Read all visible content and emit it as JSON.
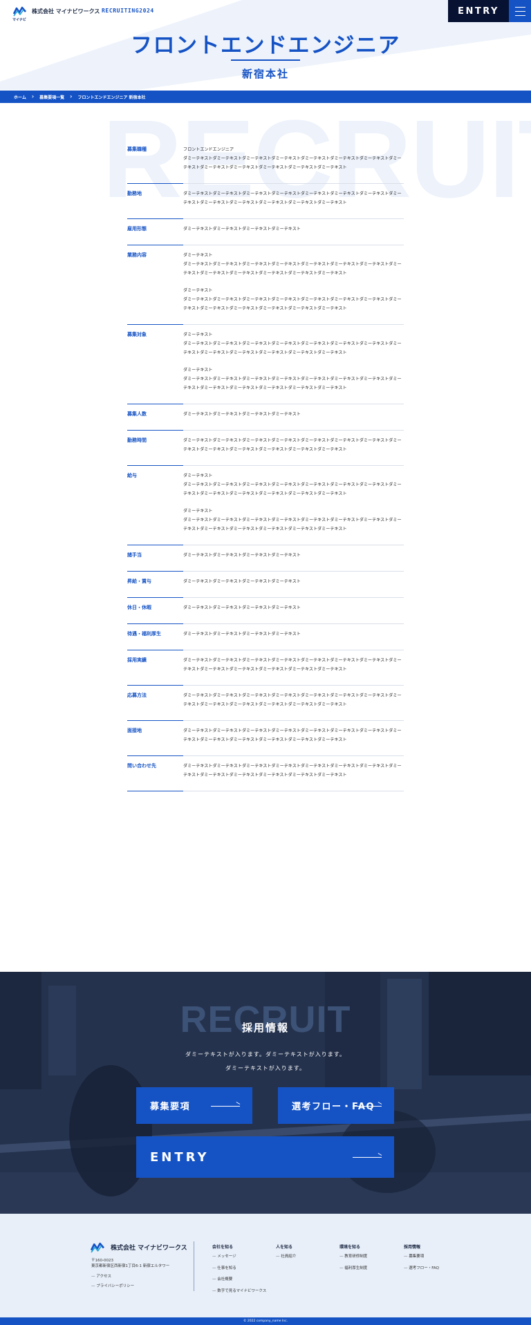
{
  "header": {
    "logo_text": "マイナビ",
    "company": "株式会社 マイナビワークス",
    "recruiting": "RECRUITING2024",
    "entry": "ENTRY"
  },
  "hero": {
    "title": "フロントエンドエンジニア",
    "subtitle": "新宿本社"
  },
  "breadcrumb": [
    "ホーム",
    "募集要項一覧",
    "フロントエンドエンジニア 新宿本社"
  ],
  "bg_word": "RECRUIT",
  "requirements": [
    {
      "label": "募集職種",
      "paras": [
        "フロントエンドエンジニア\nダミーテキストダミーテキストダミーテキストダミーテキストダミーテキストダミーテキストダミーテキストダミーテキストダミーテキストダミーテキストダミーテキストダミーテキストダミーテキスト"
      ]
    },
    {
      "label": "勤務地",
      "paras": [
        "ダミーテキストダミーテキストダミーテキストダミーテキストダミーテキストダミーテキストダミーテキストダミーテキストダミーテキストダミーテキストダミーテキストダミーテキストダミーテキスト"
      ]
    },
    {
      "label": "雇用形態",
      "paras": [
        "ダミーテキストダミーテキストダミーテキストダミーテキスト"
      ]
    },
    {
      "label": "業務内容",
      "paras": [
        "ダミーテキスト\nダミーテキストダミーテキストダミーテキストダミーテキストダミーテキストダミーテキストダミーテキストダミーテキストダミーテキストダミーテキストダミーテキストダミーテキストダミーテキスト",
        "ダミーテキスト\nダミーテキストダミーテキストダミーテキストダミーテキストダミーテキストダミーテキストダミーテキストダミーテキストダミーテキストダミーテキストダミーテキストダミーテキストダミーテキスト"
      ]
    },
    {
      "label": "募集対象",
      "paras": [
        "ダミーテキスト\nダミーテキストダミーテキストダミーテキストダミーテキストダミーテキストダミーテキストダミーテキストダミーテキストダミーテキストダミーテキストダミーテキストダミーテキストダミーテキスト",
        "ダミーテキスト\nダミーテキストダミーテキストダミーテキストダミーテキストダミーテキストダミーテキストダミーテキストダミーテキストダミーテキストダミーテキストダミーテキストダミーテキストダミーテキスト"
      ]
    },
    {
      "label": "募集人数",
      "paras": [
        "ダミーテキストダミーテキストダミーテキストダミーテキスト"
      ]
    },
    {
      "label": "勤務時間",
      "paras": [
        "ダミーテキストダミーテキストダミーテキストダミーテキストダミーテキストダミーテキストダミーテキストダミーテキストダミーテキストダミーテキストダミーテキストダミーテキストダミーテキスト"
      ]
    },
    {
      "label": "給与",
      "paras": [
        "ダミーテキスト\nダミーテキストダミーテキストダミーテキストダミーテキストダミーテキストダミーテキストダミーテキストダミーテキストダミーテキストダミーテキストダミーテキストダミーテキストダミーテキスト",
        "ダミーテキスト\nダミーテキストダミーテキストダミーテキストダミーテキストダミーテキストダミーテキストダミーテキストダミーテキストダミーテキストダミーテキストダミーテキストダミーテキストダミーテキスト"
      ]
    },
    {
      "label": "諸手当",
      "paras": [
        "ダミーテキストダミーテキストダミーテキストダミーテキスト"
      ]
    },
    {
      "label": "昇給・賞与",
      "paras": [
        "ダミーテキストダミーテキストダミーテキストダミーテキスト"
      ]
    },
    {
      "label": "休日・休暇",
      "paras": [
        "ダミーテキストダミーテキストダミーテキストダミーテキスト"
      ]
    },
    {
      "label": "待遇・福利厚生",
      "paras": [
        "ダミーテキストダミーテキストダミーテキストダミーテキスト"
      ]
    },
    {
      "label": "採用実績",
      "paras": [
        "ダミーテキストダミーテキストダミーテキストダミーテキストダミーテキストダミーテキストダミーテキストダミーテキストダミーテキストダミーテキストダミーテキストダミーテキストダミーテキスト"
      ]
    },
    {
      "label": "応募方法",
      "paras": [
        "ダミーテキストダミーテキストダミーテキストダミーテキストダミーテキストダミーテキストダミーテキストダミーテキストダミーテキストダミーテキストダミーテキストダミーテキストダミーテキスト"
      ]
    },
    {
      "label": "面接地",
      "paras": [
        "ダミーテキストダミーテキストダミーテキストダミーテキストダミーテキストダミーテキストダミーテキストダミーテキストダミーテキストダミーテキストダミーテキストダミーテキストダミーテキスト"
      ]
    },
    {
      "label": "問い合わせ先",
      "paras": [
        "ダミーテキストダミーテキストダミーテキストダミーテキストダミーテキストダミーテキストダミーテキストダミーテキストダミーテキストダミーテキストダミーテキストダミーテキストダミーテキスト"
      ]
    }
  ],
  "recruit": {
    "bg_word": "RECRUIT",
    "heading": "採用情報",
    "text1": "ダミーテキストが入ります。ダミーテキストが入ります。",
    "text2": "ダミーテキストが入ります。",
    "btn_requirements": "募集要項",
    "btn_flow": "選考フロー・FAQ",
    "btn_entry": "ENTRY"
  },
  "footer": {
    "company": "株式会社 マイナビワークス",
    "postal": "〒160-0023",
    "address": "東京都新宿区西新宿1丁目6-1 新宿エルタワー",
    "links_left": [
      "アクセス",
      "プライバシーポリシー"
    ],
    "col1_head": "会社を知る",
    "col1": [
      "メッセージ",
      "仕事を知る",
      "会社概要",
      "数字で見るマイナビワークス"
    ],
    "col2_head": "人を知る",
    "col2": [
      "社員紹介"
    ],
    "col3_head": "環境を知る",
    "col3": [
      "教育研修制度",
      "福利厚生制度"
    ],
    "col4_head": "採用情報",
    "col4": [
      "募集要項",
      "選考フロー・FAQ"
    ],
    "copyright": "© 2022 company_name Inc."
  },
  "colors": {
    "primary": "#1553c5",
    "navy": "#071233",
    "footer_bg": "#e8eff9"
  }
}
